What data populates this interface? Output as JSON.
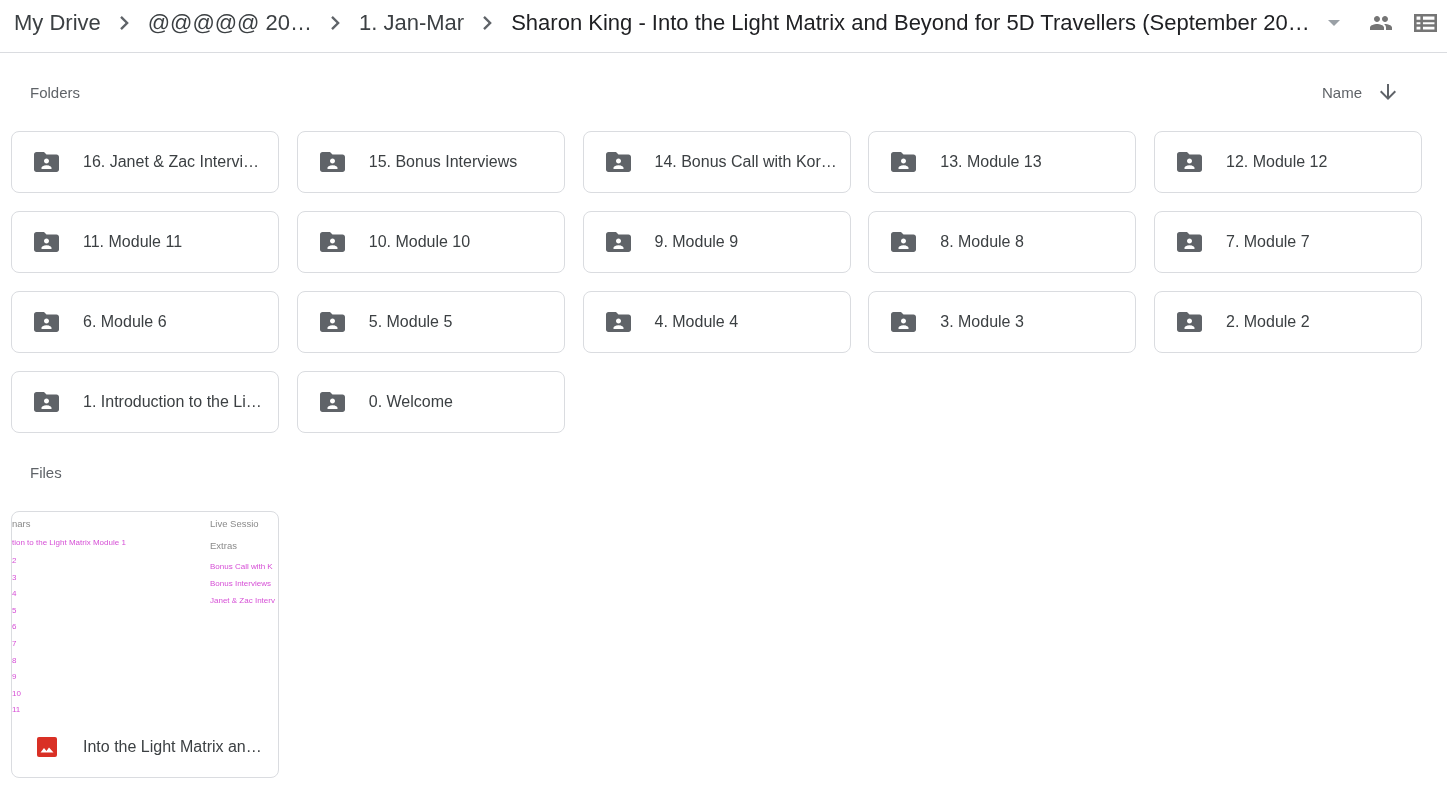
{
  "breadcrumb": [
    {
      "label": "My Drive",
      "kind": "link"
    },
    {
      "label": "@@@@@ 20…",
      "kind": "link"
    },
    {
      "label": "1. Jan-Mar",
      "kind": "link"
    },
    {
      "label": "Sharon King - Into the Light Matrix and Beyond for 5D Travellers (September 20…",
      "kind": "current"
    }
  ],
  "folders_section": {
    "title": "Folders",
    "sort_label": "Name"
  },
  "folders": [
    {
      "name": "16. Janet & Zac Intervi…"
    },
    {
      "name": "15. Bonus Interviews"
    },
    {
      "name": "14. Bonus Call with Kor…"
    },
    {
      "name": "13. Module 13"
    },
    {
      "name": "12. Module 12"
    },
    {
      "name": "11. Module 11"
    },
    {
      "name": "10. Module 10"
    },
    {
      "name": "9. Module 9"
    },
    {
      "name": "8. Module 8"
    },
    {
      "name": "7. Module 7"
    },
    {
      "name": "6. Module 6"
    },
    {
      "name": "5. Module 5"
    },
    {
      "name": "4. Module 4"
    },
    {
      "name": "3. Module 3"
    },
    {
      "name": "2. Module 2"
    },
    {
      "name": "1. Introduction to the Li…"
    },
    {
      "name": "0. Welcome"
    }
  ],
  "files_section": {
    "title": "Files"
  },
  "files": [
    {
      "name": "Into the Light Matrix an…",
      "thumbnail": {
        "left_heading": "nars",
        "left_links": [
          "tion to the Light Matrix Module 1",
          "2",
          "3",
          "4",
          "5",
          "6",
          "7",
          "8",
          "9",
          "10",
          "11"
        ],
        "right_headings": [
          "Live Sessio",
          "Extras"
        ],
        "right_links": [
          "Bonus Call with K",
          "Bonus Interviews",
          "Janet & Zac Interv"
        ]
      }
    }
  ]
}
